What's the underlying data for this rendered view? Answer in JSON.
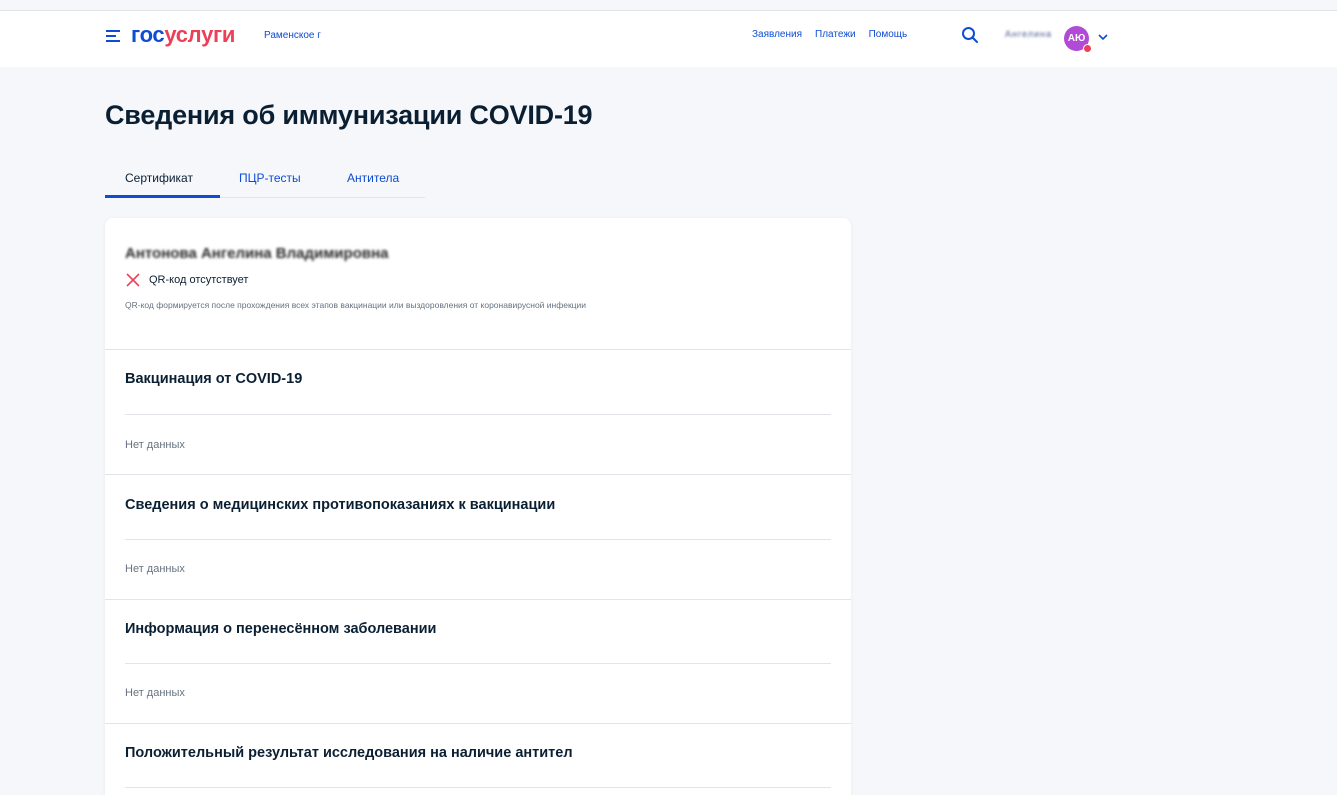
{
  "header": {
    "logo_part1": "гос",
    "logo_part2": "услуги",
    "city": "Раменское г",
    "nav": [
      "Заявления",
      "Платежи",
      "Помощь"
    ],
    "username": "Ангелина",
    "avatar_initials": "АЮ",
    "brand_color": "#0d4cd3",
    "accent_color": "#ee3f58"
  },
  "page": {
    "title": "Сведения об иммунизации COVID-19",
    "tabs": [
      "Сертификат",
      "ПЦР-тесты",
      "Антитела"
    ],
    "active_tab": "Сертификат"
  },
  "certificate": {
    "person_name": "Антонова Ангелина Владимировна",
    "qr_status": "QR-код отсутствует",
    "qr_note": "QR-код формируется после прохождения всех этапов вакцинации или выздоровления от коронавирусной инфекции"
  },
  "sections": [
    {
      "title": "Вакцинация от COVID-19",
      "value": "Нет данных"
    },
    {
      "title": "Сведения о медицинских противопоказаниях к вакцинации",
      "value": "Нет данных"
    },
    {
      "title": "Информация о перенесённом заболевании",
      "value": "Нет данных"
    },
    {
      "title": "Положительный результат исследования на наличие антител",
      "value": ""
    }
  ]
}
